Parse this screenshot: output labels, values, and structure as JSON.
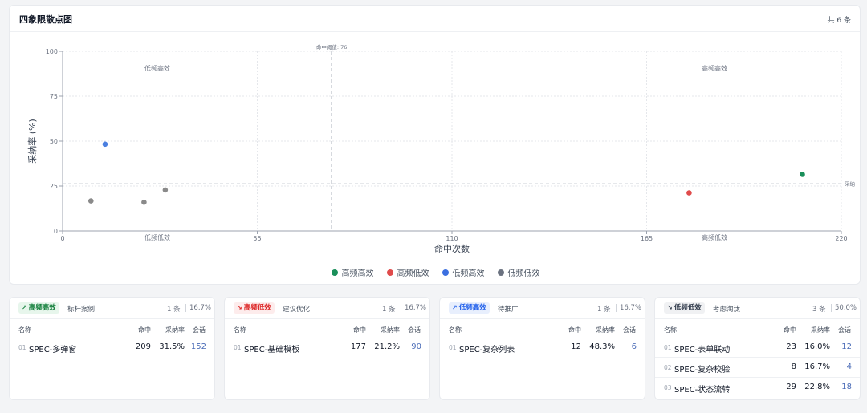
{
  "chart": {
    "title": "四象限散点图",
    "total": "共 6 条",
    "y_axis_label": "采纳率 (%)",
    "x_axis_label": "命中次数",
    "hit_threshold_label": "命中阈值: 76",
    "adopt_threshold_label": "采纳",
    "quadrant_labels": {
      "top_left": "低频高效",
      "top_right": "高频高效",
      "bottom_left": "低频低效",
      "bottom_right": "高频低效"
    }
  },
  "chart_data": {
    "type": "scatter",
    "xlabel": "命中次数",
    "ylabel": "采纳率 (%)",
    "xlim": [
      0,
      220
    ],
    "ylim": [
      0,
      100
    ],
    "x_ticks": [
      0,
      55,
      110,
      165,
      220
    ],
    "y_ticks": [
      0,
      25,
      50,
      75,
      100
    ],
    "grid": true,
    "thresholds": {
      "x": 76,
      "y": 26.2
    },
    "series": [
      {
        "name": "高频高效",
        "color": "#1a8f5a",
        "points": [
          [
            209,
            31.5
          ]
        ]
      },
      {
        "name": "高频低效",
        "color": "#e04b4b",
        "points": [
          [
            177,
            21.2
          ]
        ]
      },
      {
        "name": "低频高效",
        "color": "#4a7fe0",
        "points": [
          [
            12,
            48.3
          ]
        ]
      },
      {
        "name": "低频低效",
        "color": "#8a8a8a",
        "points": [
          [
            23,
            16.0
          ],
          [
            8,
            16.7
          ],
          [
            29,
            22.8
          ]
        ]
      }
    ]
  },
  "legend": [
    {
      "label": "高频高效",
      "color": "#1a8f5a"
    },
    {
      "label": "高频低效",
      "color": "#e04b4b"
    },
    {
      "label": "低频高效",
      "color": "#3b6fe0"
    },
    {
      "label": "低频低效",
      "color": "#6b7280"
    }
  ],
  "columns": {
    "name": "名称",
    "hits": "命中",
    "rate": "采纳率",
    "sessions": "会话"
  },
  "quadrants": [
    {
      "badge": "高频高效",
      "icon": "↗",
      "badge_color": "#15803d",
      "badge_bg": "#e7f6ec",
      "desc": "标杆案例",
      "count": "1 条",
      "pct": "16.7%",
      "rows": [
        {
          "idx": "01",
          "name": "SPEC-多弹窗",
          "hits": "209",
          "rate": "31.5%",
          "sessions": "152"
        }
      ]
    },
    {
      "badge": "高频低效",
      "icon": "↘",
      "badge_color": "#dc2626",
      "badge_bg": "#fdecec",
      "desc": "建议优化",
      "count": "1 条",
      "pct": "16.7%",
      "rows": [
        {
          "idx": "01",
          "name": "SPEC-基础模板",
          "hits": "177",
          "rate": "21.2%",
          "sessions": "90"
        }
      ]
    },
    {
      "badge": "低频高效",
      "icon": "↗",
      "badge_color": "#2563eb",
      "badge_bg": "#e8effd",
      "desc": "待推广",
      "count": "1 条",
      "pct": "16.7%",
      "rows": [
        {
          "idx": "01",
          "name": "SPEC-复杂列表",
          "hits": "12",
          "rate": "48.3%",
          "sessions": "6"
        }
      ]
    },
    {
      "badge": "低频低效",
      "icon": "↘",
      "badge_color": "#374151",
      "badge_bg": "#f0f1f3",
      "desc": "考虑淘汰",
      "count": "3 条",
      "pct": "50.0%",
      "rows": [
        {
          "idx": "01",
          "name": "SPEC-表单联动",
          "hits": "23",
          "rate": "16.0%",
          "sessions": "12"
        },
        {
          "idx": "02",
          "name": "SPEC-复杂校验",
          "hits": "8",
          "rate": "16.7%",
          "sessions": "4"
        },
        {
          "idx": "03",
          "name": "SPEC-状态流转",
          "hits": "29",
          "rate": "22.8%",
          "sessions": "18"
        }
      ]
    }
  ]
}
